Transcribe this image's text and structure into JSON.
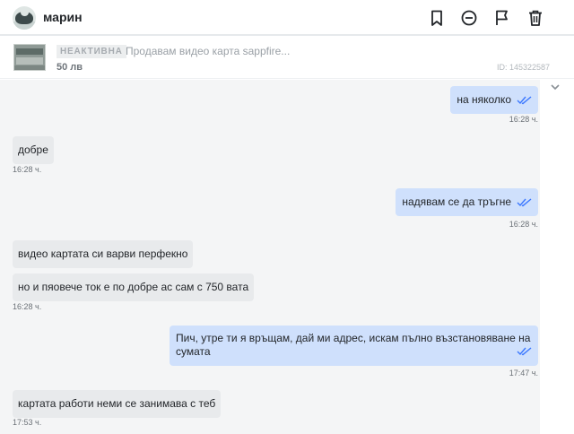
{
  "header": {
    "username": "марин",
    "icons": [
      "bookmark-icon",
      "block-icon",
      "flag-icon",
      "trash-icon"
    ]
  },
  "listing": {
    "status": "НЕАКТИВНА",
    "title": "Продавам видео карта sappfire...",
    "price": "50 лв",
    "id": "ID: 145322587"
  },
  "messages": [
    {
      "direction": "out",
      "text": "на няколко",
      "time": "16:28 ч."
    },
    {
      "direction": "in",
      "text": "добре",
      "time": "16:28 ч."
    },
    {
      "direction": "out",
      "text": "надявам се да тръгне",
      "time": "16:28 ч."
    },
    {
      "direction": "in",
      "text": "видео картата си варви перфекно",
      "time": ""
    },
    {
      "direction": "in",
      "text": "но и пяовече ток е по добре ас сам с 750 вата",
      "time": "16:28 ч."
    },
    {
      "direction": "out",
      "text": "Пич, утре ти я връщам, дай ми адрес, искам пълно възстановяване на сумата",
      "time": "17:47 ч."
    },
    {
      "direction": "in",
      "text": "картата работи неми се занимава с теб",
      "time": "17:53 ч."
    }
  ],
  "colors": {
    "outgoing_bubble": "#cfe0fc",
    "incoming_bubble": "#e8eaec",
    "read_ticks": "#3a77ff"
  }
}
